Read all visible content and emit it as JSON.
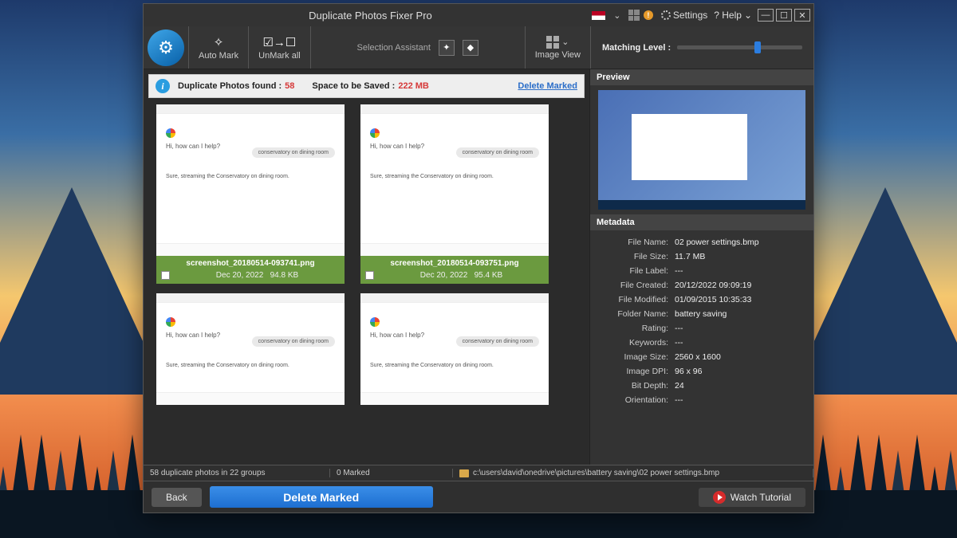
{
  "titlebar": {
    "title": "Duplicate Photos Fixer Pro",
    "settings": "Settings",
    "help": "? Help",
    "flag_chevron": "⌄"
  },
  "toolbar": {
    "auto_mark": "Auto Mark",
    "unmark_all": "UnMark all",
    "selection_assistant": "Selection Assistant",
    "image_view": "Image View",
    "matching_level": "Matching Level :"
  },
  "infobar": {
    "found_label": "Duplicate Photos found :",
    "found_count": "58",
    "space_label": "Space to be Saved :",
    "space_value": "222 MB",
    "delete_link": "Delete Marked"
  },
  "chat": {
    "q": "Hi, how can I help?",
    "user": "conservatory on dining room",
    "reply": "Sure, streaming the Conservatory on dining room."
  },
  "thumbs": [
    {
      "filename": "screenshot_20180514-093741.png",
      "date": "Dec 20, 2022",
      "size": "94.8 KB"
    },
    {
      "filename": "screenshot_20180514-093751.png",
      "date": "Dec 20, 2022",
      "size": "95.4 KB"
    }
  ],
  "preview": {
    "heading": "Preview"
  },
  "metadata": {
    "heading": "Metadata",
    "rows": [
      {
        "k": "File Name:",
        "v": "02 power settings.bmp"
      },
      {
        "k": "File Size:",
        "v": "11.7 MB"
      },
      {
        "k": "File Label:",
        "v": "---"
      },
      {
        "k": "File Created:",
        "v": "20/12/2022 09:09:19"
      },
      {
        "k": "File Modified:",
        "v": "01/09/2015 10:35:33"
      },
      {
        "k": "Folder Name:",
        "v": "battery saving"
      },
      {
        "k": "Rating:",
        "v": "---"
      },
      {
        "k": "Keywords:",
        "v": "---"
      },
      {
        "k": "Image Size:",
        "v": "2560 x 1600"
      },
      {
        "k": "Image DPI:",
        "v": "96 x 96"
      },
      {
        "k": "Bit Depth:",
        "v": "24"
      },
      {
        "k": "Orientation:",
        "v": "---"
      }
    ]
  },
  "status": {
    "summary": "58 duplicate photos in 22 groups",
    "marked": "0 Marked",
    "path": "c:\\users\\david\\onedrive\\pictures\\battery saving\\02 power settings.bmp"
  },
  "footer": {
    "back": "Back",
    "delete": "Delete Marked",
    "watch": "Watch Tutorial"
  }
}
